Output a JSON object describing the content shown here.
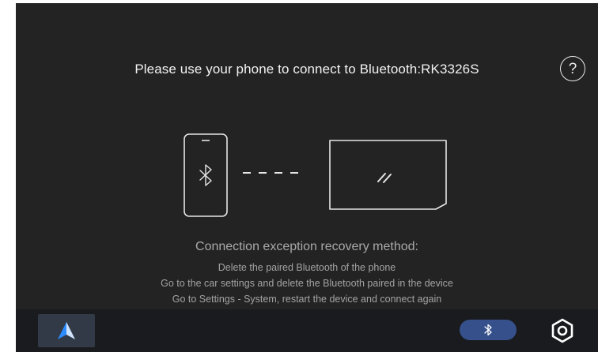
{
  "main": {
    "title": "Please use your phone to connect to Bluetooth:RK3326S",
    "help_label": "?"
  },
  "recovery": {
    "heading": "Connection exception recovery method:",
    "steps": [
      "Delete the paired Bluetooth of the phone",
      "Go to the car settings and delete the Bluetooth paired in the device",
      "Go to Settings - System, restart the device and connect again"
    ]
  },
  "dock": {
    "items": [
      "home-button",
      "bluetooth-toggle",
      "settings-button"
    ]
  },
  "colors": {
    "background": "#232323",
    "dock_background": "#1a1b1f",
    "bluetooth_pill": "#35508a",
    "home_highlight": "#333a47",
    "accent_blue": "#2b8cff"
  },
  "icons": [
    "help-icon",
    "phone-icon",
    "bluetooth-icon",
    "car-screen-icon",
    "android-auto-icon",
    "settings-icon"
  ]
}
